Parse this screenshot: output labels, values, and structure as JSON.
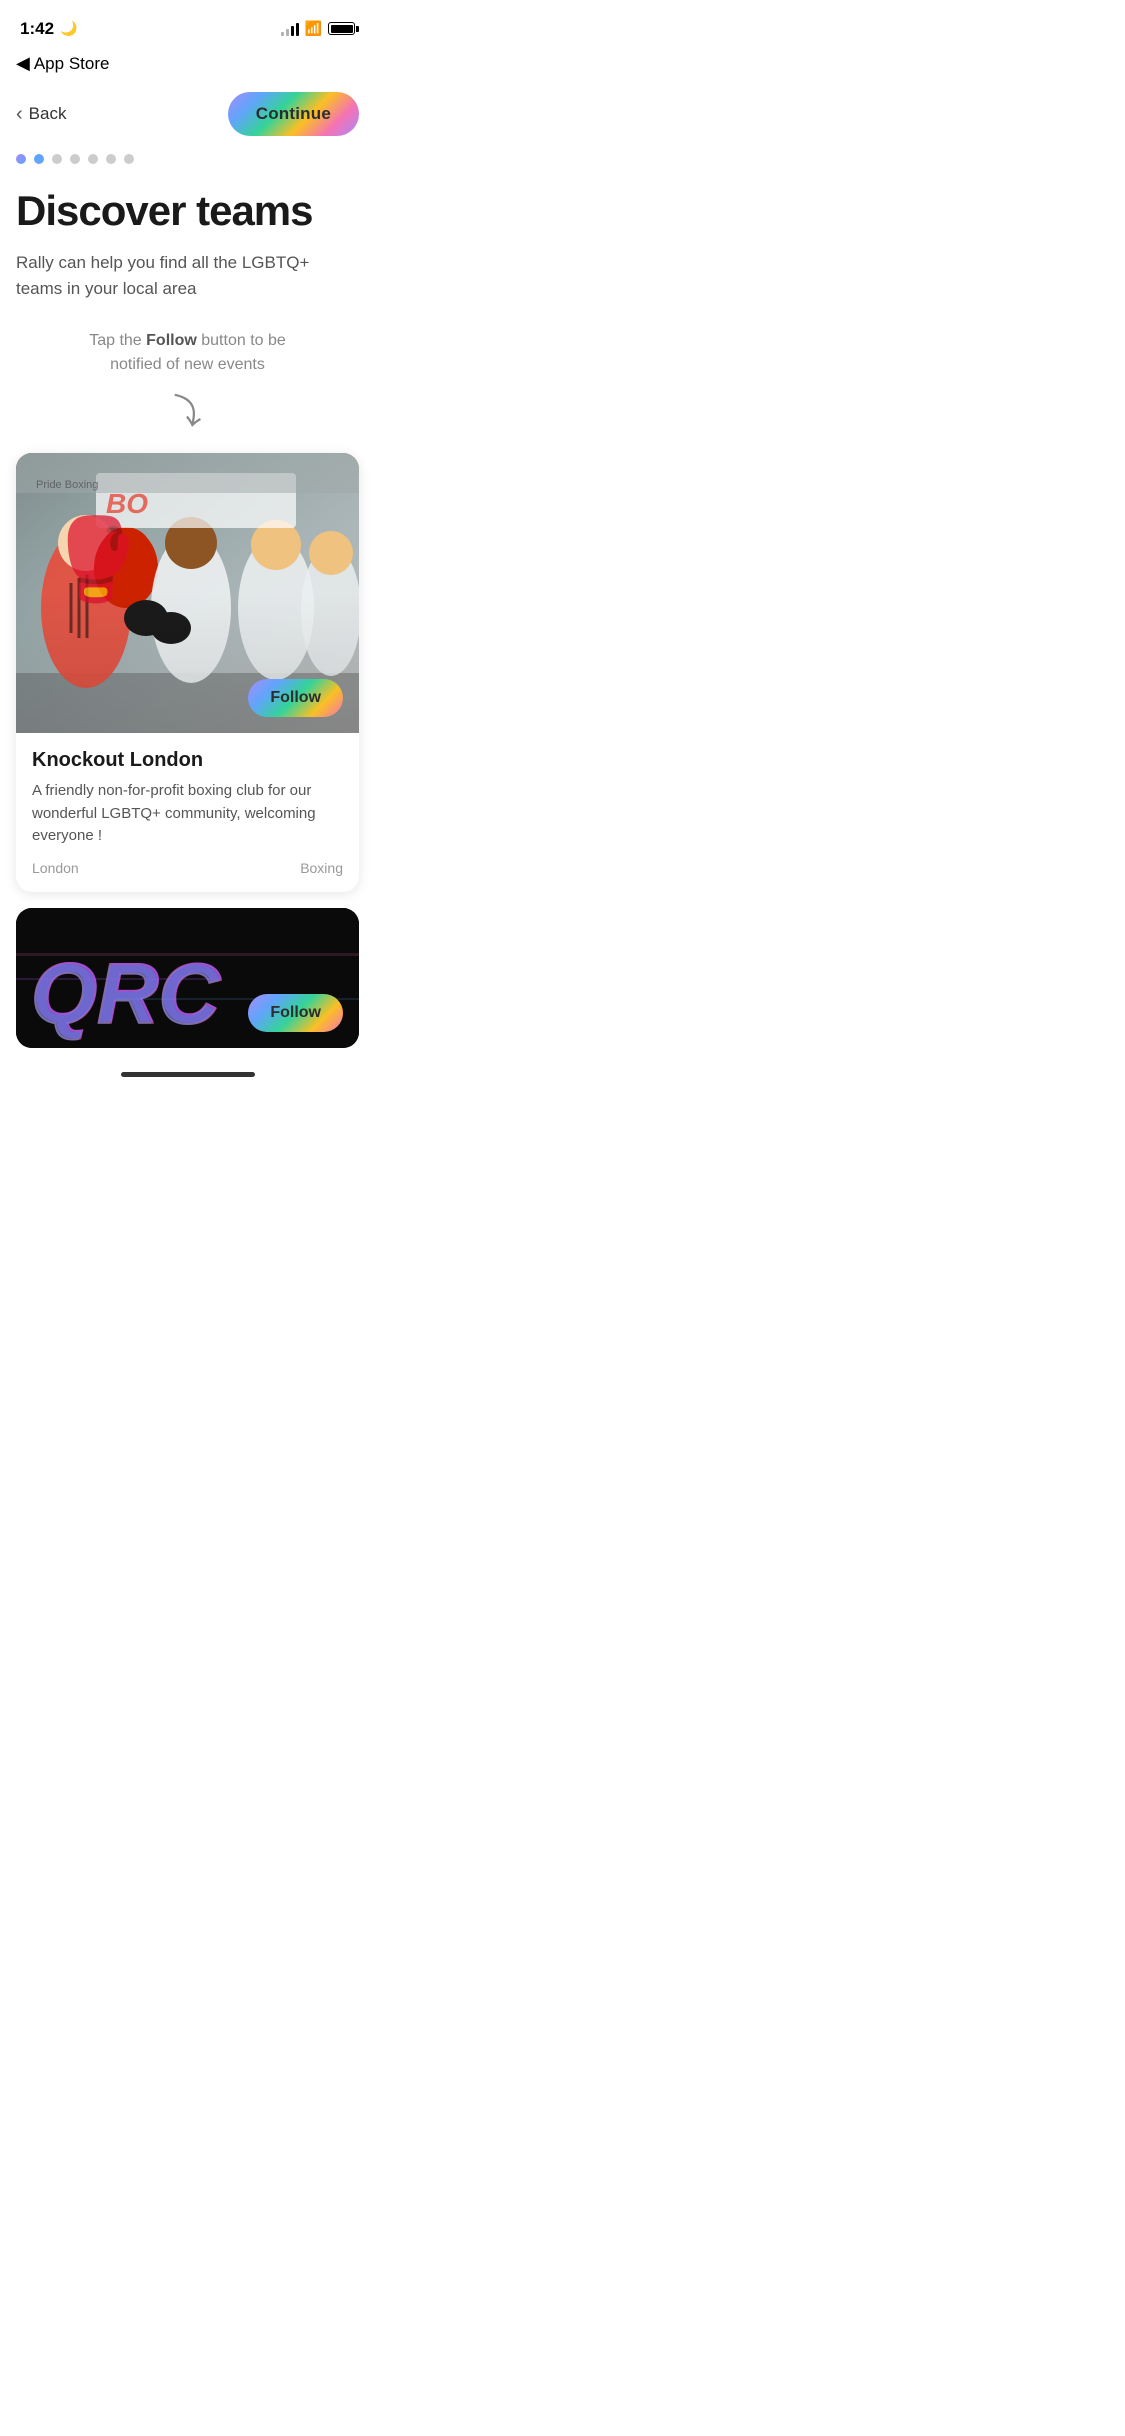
{
  "status": {
    "time": "1:42",
    "moon": "🌙",
    "wifi": "📶",
    "battery_level": "100"
  },
  "app_store_bar": {
    "back_label": "App Store"
  },
  "nav": {
    "back_label": "Back",
    "continue_label": "Continue"
  },
  "pagination": {
    "total_dots": 7,
    "active_indices": [
      0,
      1
    ]
  },
  "page": {
    "title": "Discover teams",
    "subtitle": "Rally can help you find all the LGBTQ+ teams in your local area",
    "hint_prefix": "Tap the ",
    "hint_bold": "Follow",
    "hint_suffix": " button to be notified of new events"
  },
  "team_card": {
    "follow_label": "Follow",
    "club_name": "Knockout London",
    "club_desc": "A friendly non-for-profit boxing club for our wonderful LGBTQ+ community, welcoming everyone !",
    "location": "London",
    "sport": "Boxing"
  },
  "second_card": {
    "text": "QRC",
    "follow_label": "Follow"
  },
  "home_indicator": {}
}
